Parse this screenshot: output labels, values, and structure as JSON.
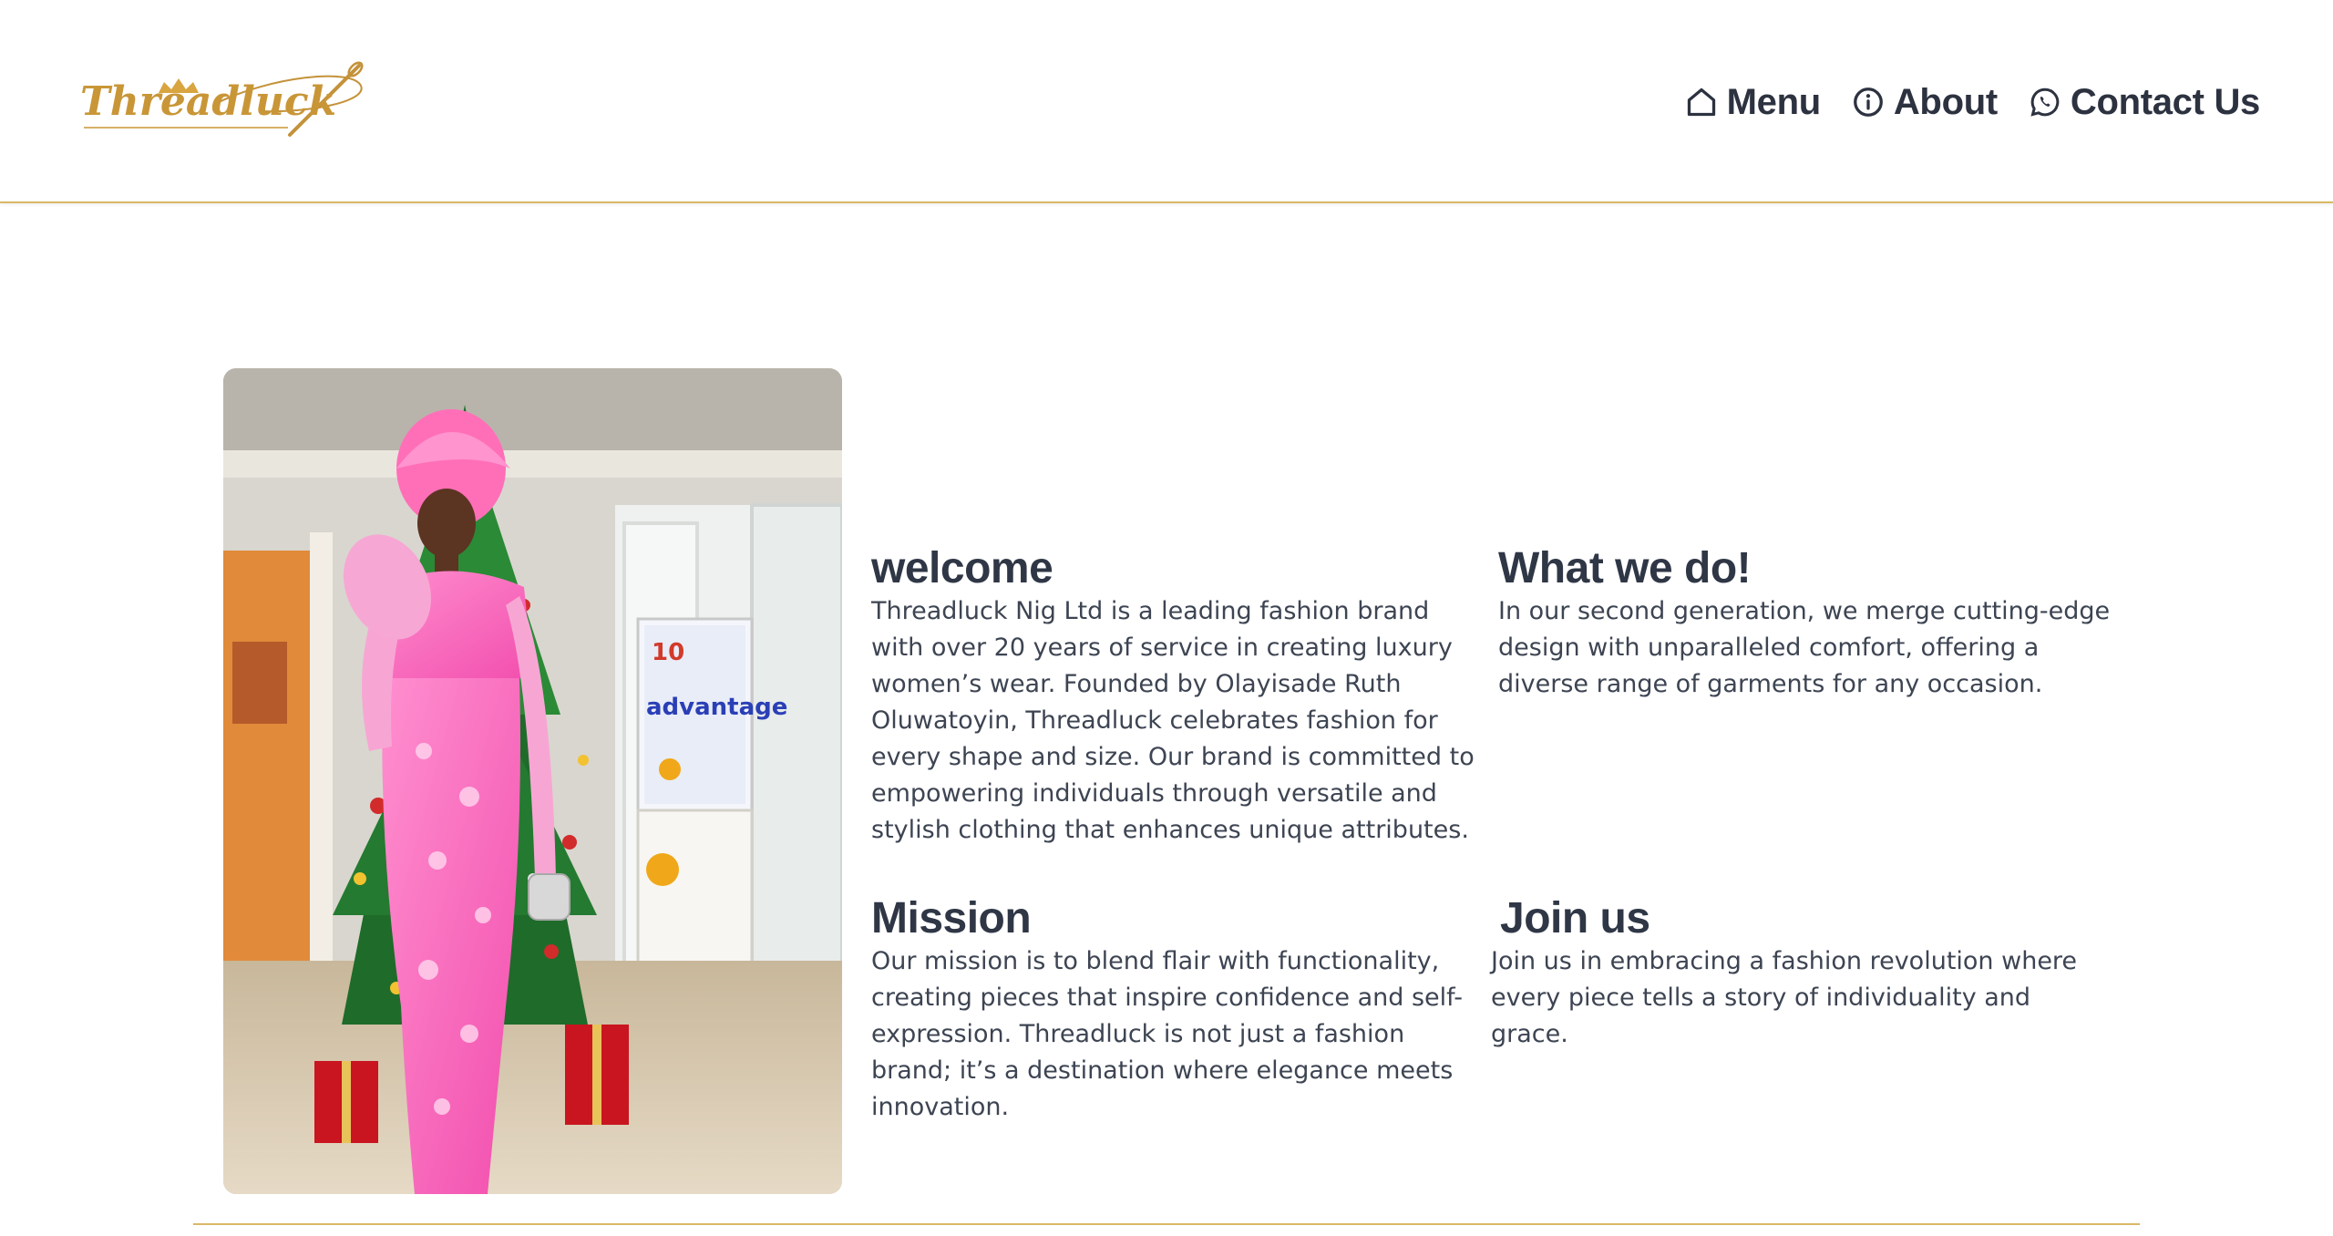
{
  "brand": {
    "logo_text": "Threadluck",
    "accent_color": "#d9b866"
  },
  "nav": {
    "items": [
      {
        "label": "Menu",
        "icon": "home-icon"
      },
      {
        "label": "About",
        "icon": "info-icon"
      },
      {
        "label": "Contact Us",
        "icon": "whatsapp-icon"
      }
    ]
  },
  "hero_image": {
    "poster_text": "advantage"
  },
  "sections": {
    "welcome": {
      "title": "welcome",
      "body": "Threadluck Nig Ltd is a leading fashion brand with over 20 years of service in creating luxury women’s wear. Founded by Olayisade Ruth Oluwatoyin, Threadluck celebrates fashion for every shape and size. Our brand is committed to empowering individuals through versatile and stylish clothing that enhances unique attributes."
    },
    "what_we_do": {
      "title": "What we do!",
      "body": "In our second generation, we merge cutting-edge design with unparalleled comfort, offering a diverse range of garments for any occasion."
    },
    "mission": {
      "title": "Mission",
      "body": "Our mission is to blend flair with functionality, creating pieces that inspire confidence and self-expression. Threadluck is not just a fashion brand; it’s a destination where elegance meets innovation."
    },
    "join_us": {
      "title": "Join us",
      "body": "Join us in embracing a fashion revolution where every piece tells a story of individuality and grace."
    }
  }
}
